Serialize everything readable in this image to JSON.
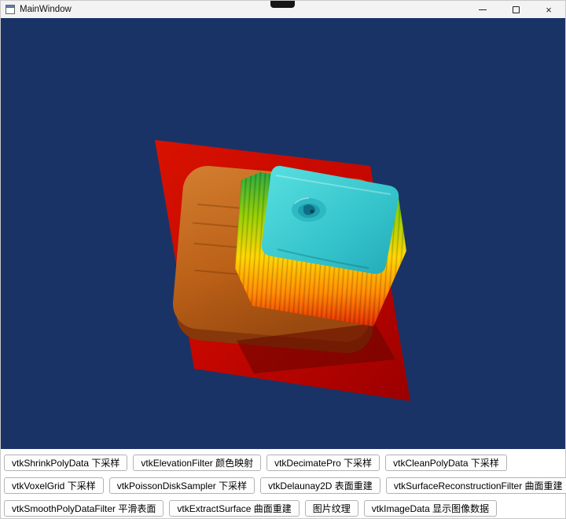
{
  "window": {
    "title": "MainWindow",
    "controls": {
      "minimize_icon": "minimize-icon",
      "maximize_icon": "maximize-icon",
      "close_glyph": "×"
    }
  },
  "viewport": {
    "background_color": "#1a3366",
    "scene": {
      "plane_color": "#c40a00",
      "slab_top_color": "#c96e24",
      "slab_edge_color": "#86380a",
      "block_top_color": "#3ccfd6",
      "elevation_ramp_colors": [
        "#27a83a",
        "#9ccf00",
        "#ffd400",
        "#ff8a00",
        "#e02800"
      ]
    }
  },
  "toolbar": {
    "rows": [
      [
        "vtkShrinkPolyData 下采样",
        "vtkElevationFilter 颜色映射",
        "vtkDecimatePro 下采样",
        "vtkCleanPolyData 下采样"
      ],
      [
        "vtkVoxelGrid 下采样",
        "vtkPoissonDiskSampler 下采样",
        "vtkDelaunay2D 表面重建",
        "vtkSurfaceReconstructionFilter 曲面重建"
      ],
      [
        "vtkSmoothPolyDataFilter 平滑表面",
        "vtkExtractSurface 曲面重建",
        "图片纹理",
        "vtkImageData 显示图像数据"
      ]
    ]
  }
}
